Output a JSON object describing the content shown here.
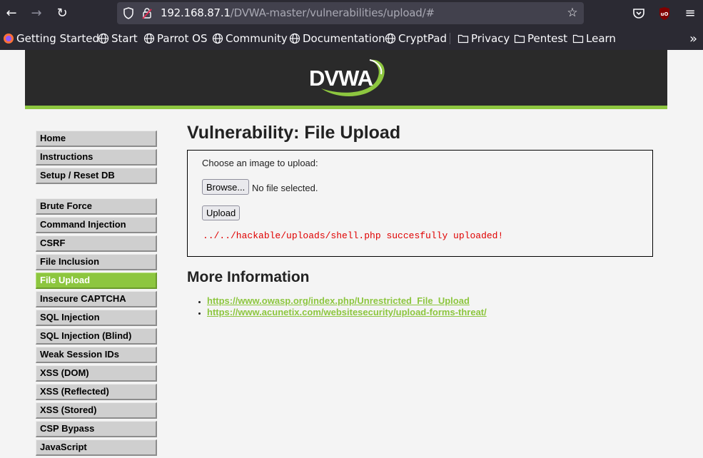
{
  "browser": {
    "url_host": "192.168.87.1",
    "url_path": "/DVWA-master/vulnerabilities/upload/#",
    "bookmarks": [
      {
        "label": "Getting Started",
        "icon": "firefox-icon"
      },
      {
        "label": "Start",
        "icon": "globe-icon"
      },
      {
        "label": "Parrot OS",
        "icon": "globe-icon"
      },
      {
        "label": "Community",
        "icon": "globe-icon"
      },
      {
        "label": "Documentation",
        "icon": "globe-icon"
      },
      {
        "label": "CryptPad",
        "icon": "globe-icon"
      },
      {
        "label": "Privacy",
        "icon": "folder-icon"
      },
      {
        "label": "Pentest",
        "icon": "folder-icon"
      },
      {
        "label": "Learn",
        "icon": "folder-icon"
      }
    ]
  },
  "header": {
    "logo_text": "DVWA"
  },
  "menu": {
    "group1": [
      "Home",
      "Instructions",
      "Setup / Reset DB"
    ],
    "group2": [
      "Brute Force",
      "Command Injection",
      "CSRF",
      "File Inclusion",
      "File Upload",
      "Insecure CAPTCHA",
      "SQL Injection",
      "SQL Injection (Blind)",
      "Weak Session IDs",
      "XSS (DOM)",
      "XSS (Reflected)",
      "XSS (Stored)",
      "CSP Bypass",
      "JavaScript"
    ],
    "selected": "File Upload"
  },
  "main": {
    "title": "Vulnerability: File Upload",
    "choose_label": "Choose an image to upload:",
    "browse_label": "Browse...",
    "no_file_text": "No file selected.",
    "upload_label": "Upload",
    "result_text": "../../hackable/uploads/shell.php succesfully uploaded!",
    "more_title": "More Information",
    "links": [
      "https://www.owasp.org/index.php/Unrestricted_File_Upload",
      "https://www.acunetix.com/websitesecurity/upload-forms-threat/"
    ]
  },
  "colors": {
    "accent": "#8dc63f",
    "header_bg": "#2a2a2a",
    "error_red": "#e00000",
    "browser_chrome": "#2b2a33"
  }
}
